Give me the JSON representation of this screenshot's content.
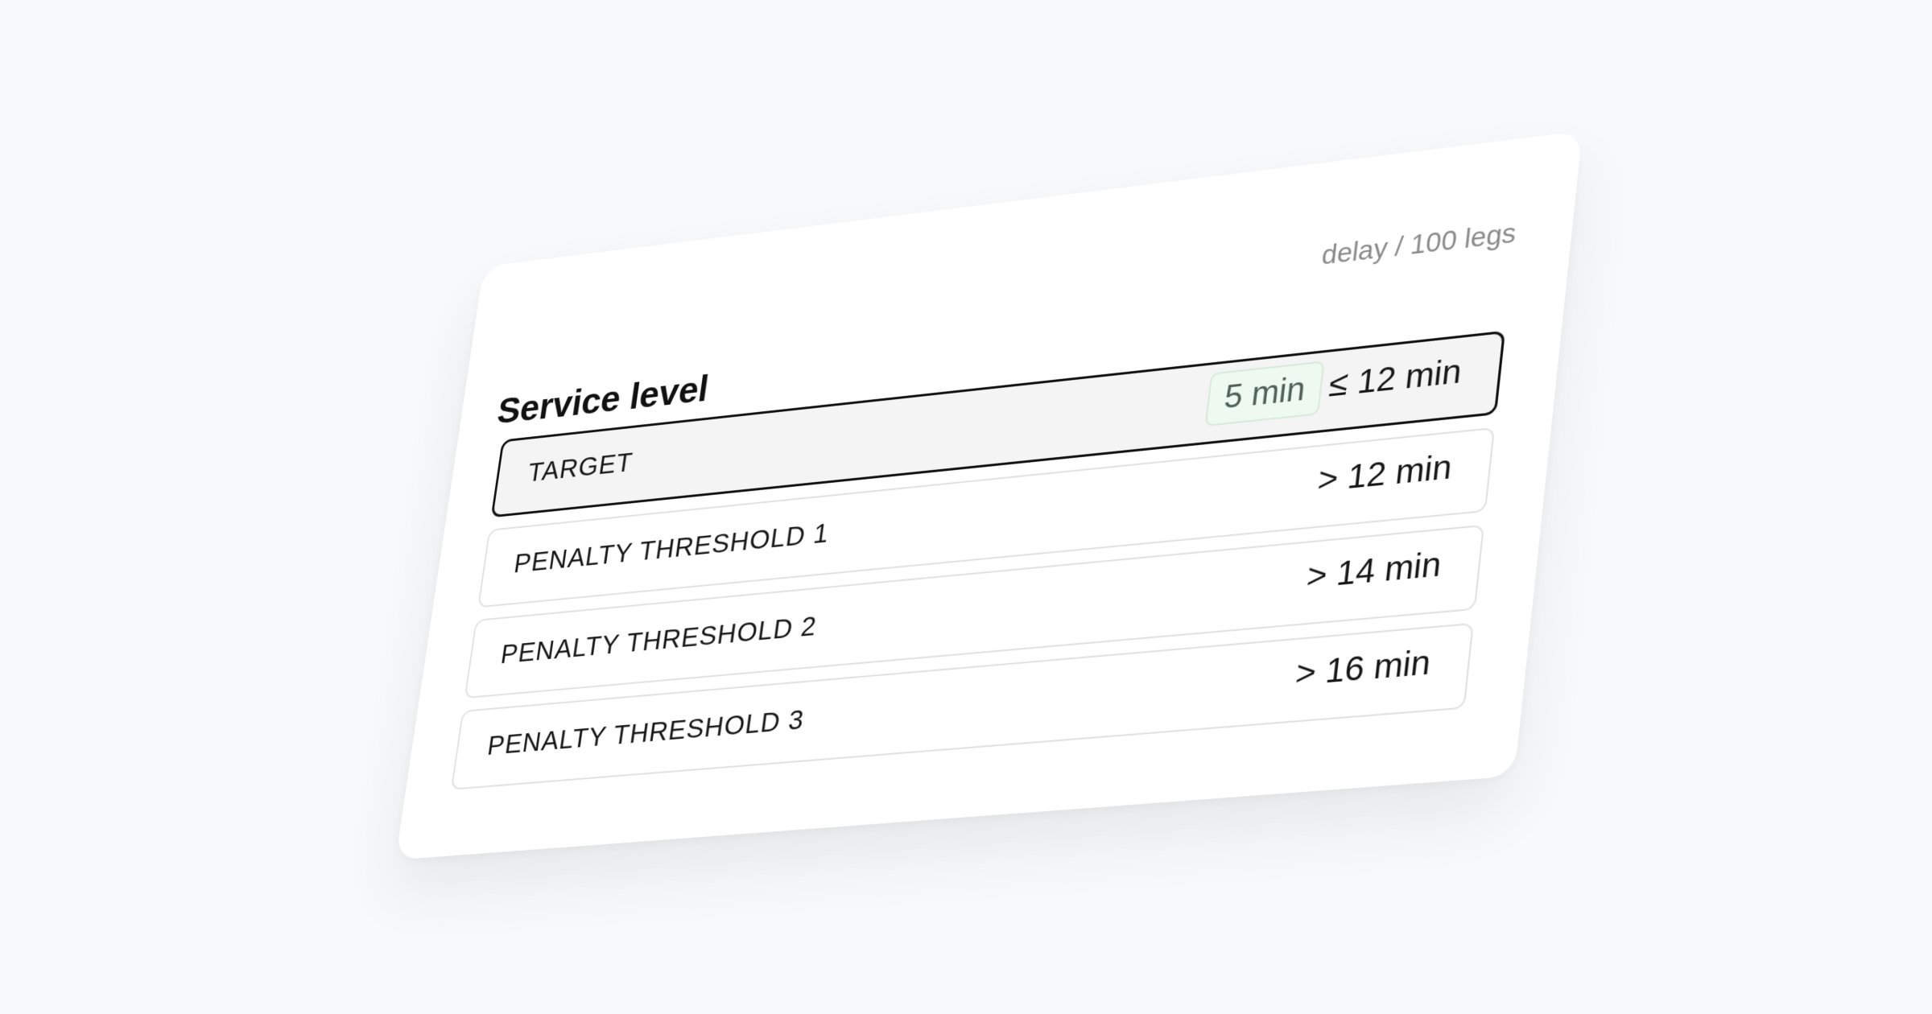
{
  "card": {
    "title": "Service level",
    "unit_label": "delay / 100 legs"
  },
  "tiers": [
    {
      "label": "TARGET",
      "value": "≤ 12 min",
      "badge": "5 min",
      "active": true
    },
    {
      "label": "PENALTY THRESHOLD 1",
      "value": "> 12 min",
      "active": false
    },
    {
      "label": "PENALTY THRESHOLD 2",
      "value": "> 14 min",
      "active": false
    },
    {
      "label": "PENALTY THRESHOLD 3",
      "value": "> 16 min",
      "active": false
    }
  ],
  "colors": {
    "background": "#f8f9fa",
    "card": "#ffffff",
    "active_row_bg": "#f4f4f4",
    "active_row_border": "#111111",
    "badge_bg": "#eef9f0",
    "badge_text": "#4f5f55"
  }
}
